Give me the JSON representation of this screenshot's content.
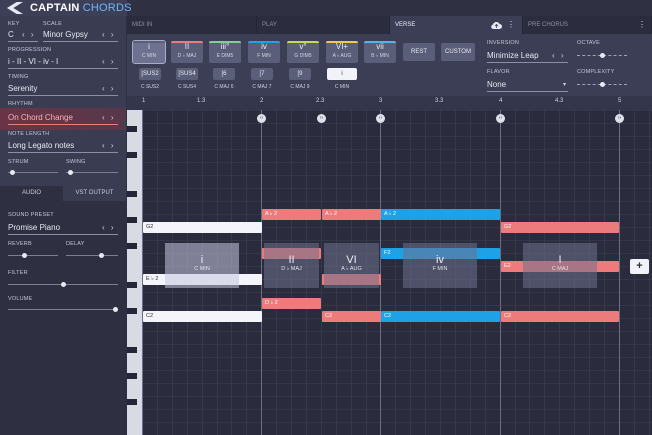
{
  "app": {
    "logo_main": "CAPTAIN",
    "logo_sub": "CHORDS"
  },
  "left": {
    "key_label": "KEY",
    "key_value": "C",
    "scale_label": "SCALE",
    "scale_value": "Minor Gypsy",
    "progression_label": "PROGRESSION",
    "progression_value": "i - II - VI - iv - I",
    "timing_label": "TIMING",
    "timing_value": "Serenity",
    "rhythm_label": "RHYTHM",
    "rhythm_value": "On Chord Change",
    "note_length_label": "NOTE LENGTH",
    "note_length_value": "Long Legato notes",
    "strum_label": "STRUM",
    "swing_label": "SWING",
    "arrows": "‹ ›",
    "tab_audio": "AUDIO",
    "tab_vst": "VST OUTPUT",
    "sound_preset_label": "SOUND PRESET",
    "sound_preset_value": "Promise Piano",
    "reverb_label": "REVERB",
    "delay_label": "DELAY",
    "filter_label": "FILTER",
    "volume_label": "VOLUME",
    "strum_level": 0.05,
    "swing_level": 0.05,
    "reverb_level": 0.3,
    "delay_level": 0.7,
    "filter_level": 0.5,
    "volume_level": 1.0
  },
  "sections": [
    {
      "label": "MIDI IN"
    },
    {
      "label": "PLAY"
    },
    {
      "label": "VERSE"
    },
    {
      "label": "PRE CHORUS"
    }
  ],
  "palette": {
    "chords": [
      {
        "num": "i",
        "name": "C MIN",
        "color": "#5b5e78"
      },
      {
        "num": "II",
        "name": "D ♭ MAJ",
        "color": "#ee7b7b"
      },
      {
        "num": "iii°",
        "name": "E DIM5",
        "color": "#7ed08a"
      },
      {
        "num": "iv",
        "name": "F MIN",
        "color": "#1ea1e6"
      },
      {
        "num": "v°",
        "name": "G DIM5",
        "color": "#c4d85c"
      },
      {
        "num": "VI+",
        "name": "A ♭ AUG",
        "color": "#f2c84b"
      },
      {
        "num": "vii",
        "name": "B ♭ MIN",
        "color": "#4fb6e8"
      }
    ],
    "rest": "REST",
    "custom": "CUSTOM",
    "extensions": [
      {
        "label": "[SUS2",
        "name": "C SUS2"
      },
      {
        "label": "[SUS4",
        "name": "C SUS4"
      },
      {
        "label": "[6",
        "name": "C MAJ 6"
      },
      {
        "label": "[7",
        "name": "C MAJ 7"
      },
      {
        "label": "[9",
        "name": "C MAJ 9"
      },
      {
        "label": "i",
        "name": "C MIN"
      }
    ],
    "inversion_label": "INVERSION",
    "inversion_value": "Minimize Leap",
    "flavor_label": "FLAVOR",
    "flavor_value": "None",
    "octave_label": "OCTAVE",
    "complexity_label": "COMPLEXITY",
    "octave_level": 0.5,
    "complexity_level": 0.5
  },
  "ruler": {
    "ticks": [
      "1",
      "1.3",
      "2",
      "2.3",
      "3",
      "3.3",
      "4",
      "4.3",
      "5"
    ]
  },
  "notes": [
    {
      "label": "G2",
      "color": "white"
    },
    {
      "label": "A ♭ 2",
      "color": "red"
    },
    {
      "label": "A ♭ 2",
      "color": "red"
    },
    {
      "label": "A ♭ 2",
      "color": "blue"
    },
    {
      "label": "G2",
      "color": "red"
    },
    {
      "label": "F2",
      "color": "blue"
    },
    {
      "label": "E ♭ 2",
      "color": "white"
    },
    {
      "label": "E2",
      "color": "red"
    },
    {
      "label": "D ♭ 2",
      "color": "red"
    },
    {
      "label": "C2",
      "color": "white"
    },
    {
      "label": "C2",
      "color": "red"
    },
    {
      "label": "C2",
      "color": "blue"
    },
    {
      "label": "C2",
      "color": "red"
    }
  ],
  "chord_blocks": [
    {
      "num": "i",
      "name": "C MIN"
    },
    {
      "num": "II",
      "name": "D ♭ MAJ"
    },
    {
      "num": "VI",
      "name": "A ♭ AUG"
    },
    {
      "num": "iv",
      "name": "F MIN"
    },
    {
      "num": "I",
      "name": "C MAJ"
    }
  ],
  "plus": "+",
  "icons": {
    "cloud": "cloud-upload-icon",
    "kebab": "more-vert-icon",
    "arrows": "chevron-lr-icon"
  }
}
